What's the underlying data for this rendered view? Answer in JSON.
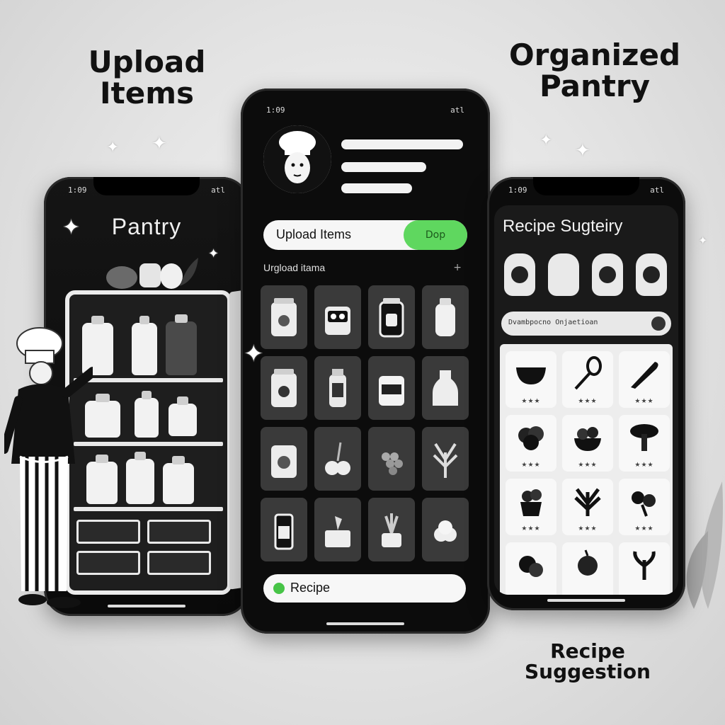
{
  "captions": {
    "upload": "Upload Items",
    "organized": "Organized Pantry",
    "recipe": "Recipe Suggestion"
  },
  "left_phone": {
    "status_left": "1:09",
    "status_right": "atl",
    "title": "Pantry"
  },
  "middle_phone": {
    "status_left": "1:09",
    "status_right": "atl",
    "upload_button_label": "Upload Items",
    "upload_go_label": "Dop",
    "section_label": "Urgload itama",
    "section_action": "+",
    "recipe_bar_label": "Recipe"
  },
  "right_phone": {
    "status_left": "1:09",
    "status_right": "atl",
    "title": "Recipe Sugteiry",
    "search_text": "Dvambpocno  Onjaetioan",
    "stars": "★★★"
  },
  "colors": {
    "accent_green": "#5fd75f",
    "phone_body": "#0c0c0c",
    "tile_bg": "#3a3a3a"
  }
}
